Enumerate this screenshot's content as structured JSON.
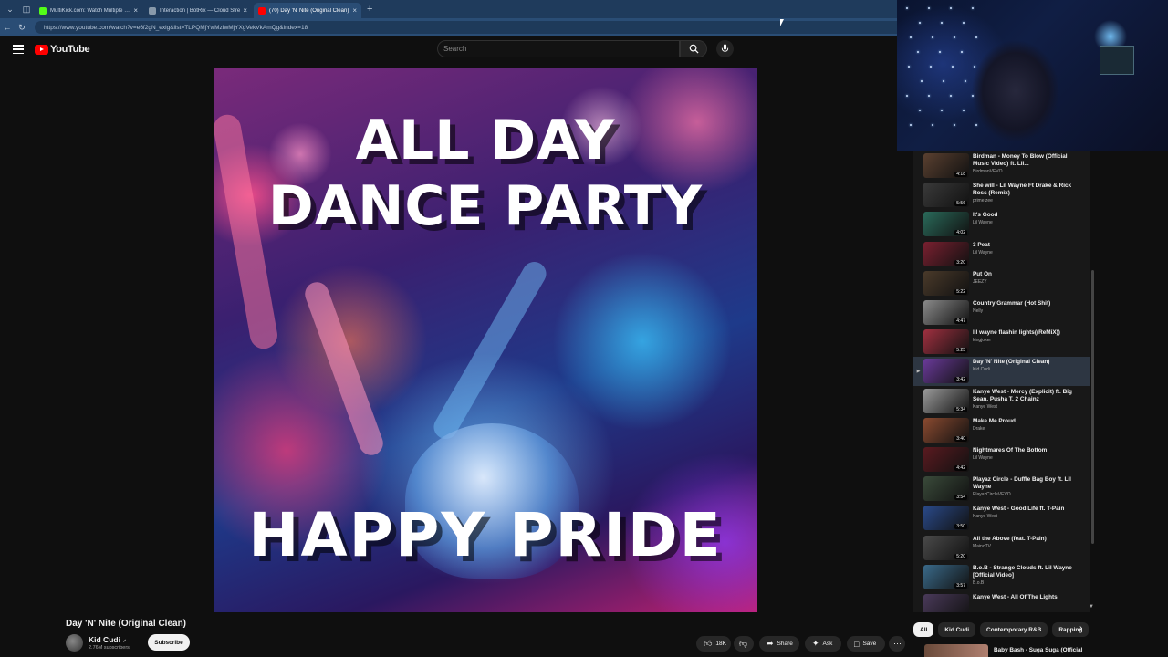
{
  "browser": {
    "tabs": [
      {
        "title": "MultiKick.com: Watch Multiple Stre",
        "favicon_color": "#53fc18",
        "active": false
      },
      {
        "title": "Interaction | BotRix — Cloud Stre",
        "favicon_color": "#8899aa",
        "active": false
      },
      {
        "title": "(70) Day 'N' Nite (Original Clean)",
        "favicon_color": "#ff0000",
        "active": true
      }
    ],
    "url": "https://www.youtube.com/watch?v=e6f2gN_exlg&list=TLPQMjYwMzIwMjYXgVekVkAmQg&index=18"
  },
  "header": {
    "logo_text": "YouTube",
    "search_placeholder": "Search"
  },
  "video": {
    "art_line1": "ALL DAY",
    "art_line2": "DANCE PARTY",
    "art_line3": "HAPPY PRIDE",
    "title": "Day 'N' Nite (Original Clean)",
    "channel": "Kid Cudi",
    "channel_verified": "✔",
    "subscribers": "2.76M subscribers",
    "subscribe_label": "Subscribe",
    "likes": "18K",
    "share_label": "Share",
    "ask_label": "Ask",
    "save_label": "Save"
  },
  "playlist": {
    "items": [
      {
        "title": "Birdman - Money To Blow (Official Music Video) ft. Lil...",
        "channel": "BirdmanVEVO",
        "duration": "4:18",
        "thumb": "#5a4030",
        "active": false
      },
      {
        "title": "She will - Lil Wayne Ft Drake & Rick Ross (Remix)",
        "channel": "prime zee",
        "duration": "5:56",
        "thumb": "#3a3a3a",
        "active": false
      },
      {
        "title": "It's Good",
        "channel": "Lil Wayne",
        "duration": "4:02",
        "thumb": "#2a6a5a",
        "active": false
      },
      {
        "title": "3 Peat",
        "channel": "Lil Wayne",
        "duration": "3:20",
        "thumb": "#7a2030",
        "active": false
      },
      {
        "title": "Put On",
        "channel": "JEEZY",
        "duration": "5:22",
        "thumb": "#4a3a2a",
        "active": false
      },
      {
        "title": "Country Grammar (Hot Shit)",
        "channel": "Nelly",
        "duration": "4:47",
        "thumb": "#8a8a8a",
        "active": false
      },
      {
        "title": "lil wayne flashin lights((ReMiX))",
        "channel": "kingjoker",
        "duration": "5:25",
        "thumb": "#a03040",
        "active": false
      },
      {
        "title": "Day 'N' Nite (Original Clean)",
        "channel": "Kid Cudi",
        "duration": "3:42",
        "thumb": "#6a3a9a",
        "active": true
      },
      {
        "title": "Kanye West - Mercy (Explicit) ft. Big Sean, Pusha T, 2 Chainz",
        "channel": "Kanye West",
        "duration": "5:34",
        "thumb": "#9a9a9a",
        "active": false
      },
      {
        "title": "Make Me Proud",
        "channel": "Drake",
        "duration": "3:40",
        "thumb": "#8a4a30",
        "active": false
      },
      {
        "title": "Nightmares Of The Bottom",
        "channel": "Lil Wayne",
        "duration": "4:42",
        "thumb": "#5a1a20",
        "active": false
      },
      {
        "title": "Playaz Circle - Duffle Bag Boy ft. Lil Wayne",
        "channel": "PlayazCircleVEVO",
        "duration": "3:54",
        "thumb": "#3a4a3a",
        "active": false
      },
      {
        "title": "Kanye West - Good Life ft. T-Pain",
        "channel": "Kanye West",
        "duration": "3:50",
        "thumb": "#2a4a8a",
        "active": false
      },
      {
        "title": "All the Above (feat. T-Pain)",
        "channel": "MainoTV",
        "duration": "5:20",
        "thumb": "#4a4a4a",
        "active": false
      },
      {
        "title": "B.o.B - Strange Clouds ft. Lil Wayne [Official Video]",
        "channel": "B.o.B",
        "duration": "3:57",
        "thumb": "#3a6a8a",
        "active": false
      },
      {
        "title": "Kanye West - All Of The Lights",
        "channel": "",
        "duration": "",
        "thumb": "#4a3a5a",
        "active": false
      }
    ],
    "active_marker": "▶"
  },
  "chips": [
    "All",
    "Kid Cudi",
    "Contemporary R&B",
    "Rapping"
  ],
  "next_up": {
    "title": "Baby Bash - Suga Suga (Official"
  }
}
